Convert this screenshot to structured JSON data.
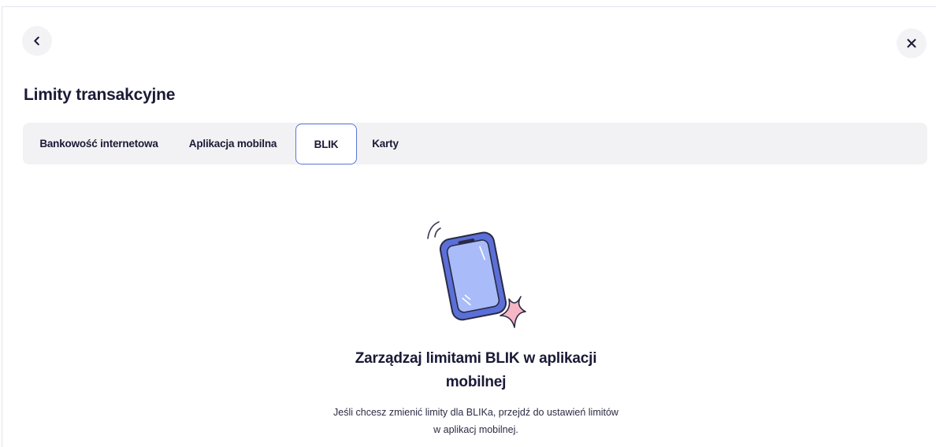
{
  "header": {
    "back_icon": "chevron-left-icon",
    "close_icon": "close-icon",
    "title": "Limity transakcyjne"
  },
  "tabs": [
    {
      "label": "Bankowość internetowa",
      "active": false
    },
    {
      "label": "Aplikacja mobilna",
      "active": false
    },
    {
      "label": "BLIK",
      "active": true
    },
    {
      "label": "Karty",
      "active": false
    }
  ],
  "empty_state": {
    "illustration": "phone-sparkle-illustration",
    "title": "Zarządzaj limitami BLIK w aplikacji mobilnej",
    "description": "Jeśli chcesz zmienić limity dla BLIKa, przejdź do ustawień limitów w aplikacj mobilnej."
  },
  "colors": {
    "active_tab_border": "#5d74d6",
    "tabbar_bg": "#f2f2f5",
    "phone_body": "#5b6fd8",
    "phone_screen": "#a9bcf9",
    "sparkle": "#f7b6c6",
    "text_dark": "#1a1a36"
  }
}
